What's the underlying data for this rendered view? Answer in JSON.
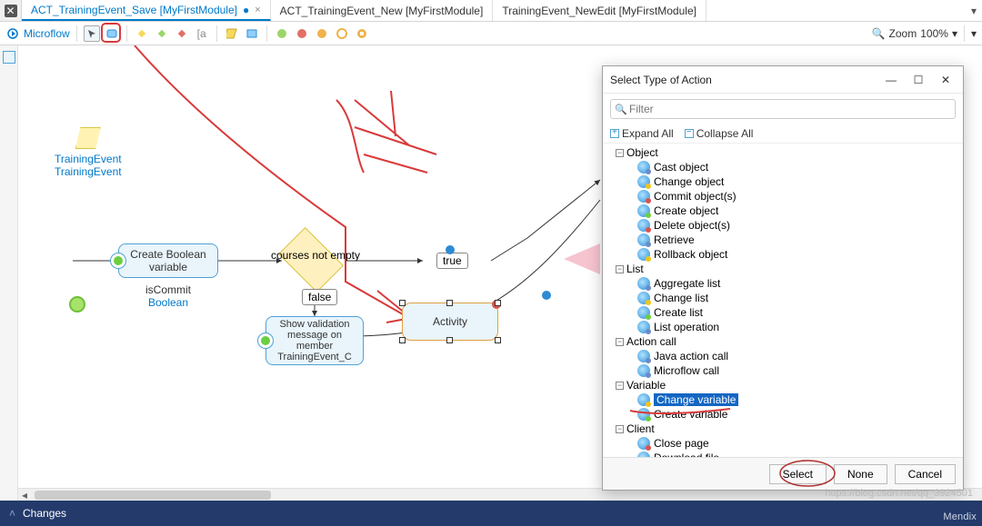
{
  "tabs": [
    {
      "label": "ACT_TrainingEvent_Save [MyFirstModule]",
      "active": true,
      "dirty": true
    },
    {
      "label": "ACT_TrainingEvent_New [MyFirstModule]",
      "active": false,
      "dirty": false
    },
    {
      "label": "TrainingEvent_NewEdit [MyFirstModule]",
      "active": false,
      "dirty": false
    }
  ],
  "toolbar": {
    "editor_label": "Microflow",
    "zoom_label": "Zoom",
    "zoom_value": "100%"
  },
  "entity": {
    "name": "TrainingEvent",
    "type": "TrainingEvent"
  },
  "nodes": {
    "createBool": {
      "label": "Create Boolean variable",
      "sub_name": "isCommit",
      "sub_type": "Boolean"
    },
    "decision": {
      "label": "courses not empty",
      "true": "true",
      "false": "false"
    },
    "validation": {
      "label": "Show validation message on member TrainingEvent_C"
    },
    "activity": {
      "label": "Activity"
    }
  },
  "dialog": {
    "title": "Select Type of Action",
    "filter_placeholder": "Filter",
    "expand_all": "Expand All",
    "collapse_all": "Collapse All",
    "groups": [
      {
        "name": "Object",
        "items": [
          "Cast object",
          "Change object",
          "Commit object(s)",
          "Create object",
          "Delete object(s)",
          "Retrieve",
          "Rollback object"
        ]
      },
      {
        "name": "List",
        "items": [
          "Aggregate list",
          "Change list",
          "Create list",
          "List operation"
        ]
      },
      {
        "name": "Action call",
        "items": [
          "Java action call",
          "Microflow call"
        ]
      },
      {
        "name": "Variable",
        "items": [
          "Change variable",
          "Create variable"
        ]
      },
      {
        "name": "Client",
        "items": [
          "Close page",
          "Download file"
        ]
      }
    ],
    "selected": "Change variable",
    "buttons": {
      "select": "Select",
      "none": "None",
      "cancel": "Cancel"
    }
  },
  "status": {
    "label": "Changes"
  },
  "watermark": "Mendix",
  "footer_url": "https://blog.csdn.net/qq_3924501"
}
